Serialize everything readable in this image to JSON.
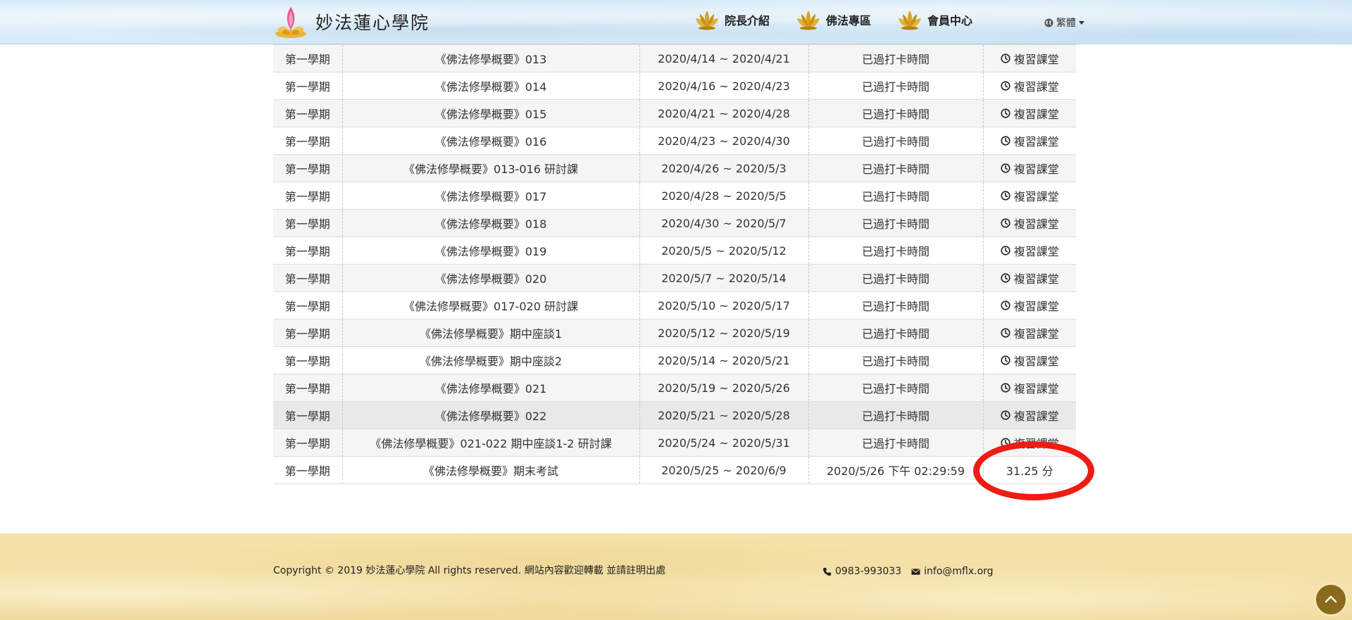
{
  "header": {
    "site_name": "妙法蓮心學院",
    "nav": [
      {
        "label": "院長介紹"
      },
      {
        "label": "佛法專區"
      },
      {
        "label": "會員中心"
      }
    ],
    "language": "繁體"
  },
  "table": {
    "rows": [
      {
        "term": "第一學期",
        "course": "《佛法修學概要》013",
        "period": "2020/4/14 ~ 2020/4/21",
        "status": "已過打卡時間",
        "action": "複習課堂"
      },
      {
        "term": "第一學期",
        "course": "《佛法修學概要》014",
        "period": "2020/4/16 ~ 2020/4/23",
        "status": "已過打卡時間",
        "action": "複習課堂"
      },
      {
        "term": "第一學期",
        "course": "《佛法修學概要》015",
        "period": "2020/4/21 ~ 2020/4/28",
        "status": "已過打卡時間",
        "action": "複習課堂"
      },
      {
        "term": "第一學期",
        "course": "《佛法修學概要》016",
        "period": "2020/4/23 ~ 2020/4/30",
        "status": "已過打卡時間",
        "action": "複習課堂"
      },
      {
        "term": "第一學期",
        "course": "《佛法修學概要》013-016 研討課",
        "period": "2020/4/26 ~ 2020/5/3",
        "status": "已過打卡時間",
        "action": "複習課堂"
      },
      {
        "term": "第一學期",
        "course": "《佛法修學概要》017",
        "period": "2020/4/28 ~ 2020/5/5",
        "status": "已過打卡時間",
        "action": "複習課堂"
      },
      {
        "term": "第一學期",
        "course": "《佛法修學概要》018",
        "period": "2020/4/30 ~ 2020/5/7",
        "status": "已過打卡時間",
        "action": "複習課堂"
      },
      {
        "term": "第一學期",
        "course": "《佛法修學概要》019",
        "period": "2020/5/5 ~ 2020/5/12",
        "status": "已過打卡時間",
        "action": "複習課堂"
      },
      {
        "term": "第一學期",
        "course": "《佛法修學概要》020",
        "period": "2020/5/7 ~ 2020/5/14",
        "status": "已過打卡時間",
        "action": "複習課堂"
      },
      {
        "term": "第一學期",
        "course": "《佛法修學概要》017-020 研討課",
        "period": "2020/5/10 ~ 2020/5/17",
        "status": "已過打卡時間",
        "action": "複習課堂"
      },
      {
        "term": "第一學期",
        "course": "《佛法修學概要》期中座談1",
        "period": "2020/5/12 ~ 2020/5/19",
        "status": "已過打卡時間",
        "action": "複習課堂"
      },
      {
        "term": "第一學期",
        "course": "《佛法修學概要》期中座談2",
        "period": "2020/5/14 ~ 2020/5/21",
        "status": "已過打卡時間",
        "action": "複習課堂"
      },
      {
        "term": "第一學期",
        "course": "《佛法修學概要》021",
        "period": "2020/5/19 ~ 2020/5/26",
        "status": "已過打卡時間",
        "action": "複習課堂"
      },
      {
        "term": "第一學期",
        "course": "《佛法修學概要》022",
        "period": "2020/5/21 ~ 2020/5/28",
        "status": "已過打卡時間",
        "action": "複習課堂"
      },
      {
        "term": "第一學期",
        "course": "《佛法修學概要》021-022 期中座談1-2 研討課",
        "period": "2020/5/24 ~ 2020/5/31",
        "status": "已過打卡時間",
        "action": "複習課堂"
      }
    ],
    "exam_row": {
      "term": "第一學期",
      "course": "《佛法修學概要》期末考試",
      "period": "2020/5/25 ~ 2020/6/9",
      "submitted": "2020/5/26 下午 02:29:59",
      "score": "31.25 分"
    }
  },
  "footer": {
    "copyright": "Copyright © 2019 妙法蓮心學院 All rights reserved. 網站內容歡迎轉載 並請註明出處",
    "phone": "0983-993033",
    "email": "info@mflx.org"
  },
  "colors": {
    "annotation_red": "#ee1c12",
    "header_blue": "#d7ebf8",
    "footer_gold": "#f3e0a6",
    "lotus_gold": "#d9a21e"
  },
  "icons": [
    "lotus-logo-icon",
    "lotus-nav-icon",
    "globe-icon",
    "caret-down-icon",
    "clock-icon",
    "phone-icon",
    "envelope-icon",
    "chevron-up-icon"
  ]
}
